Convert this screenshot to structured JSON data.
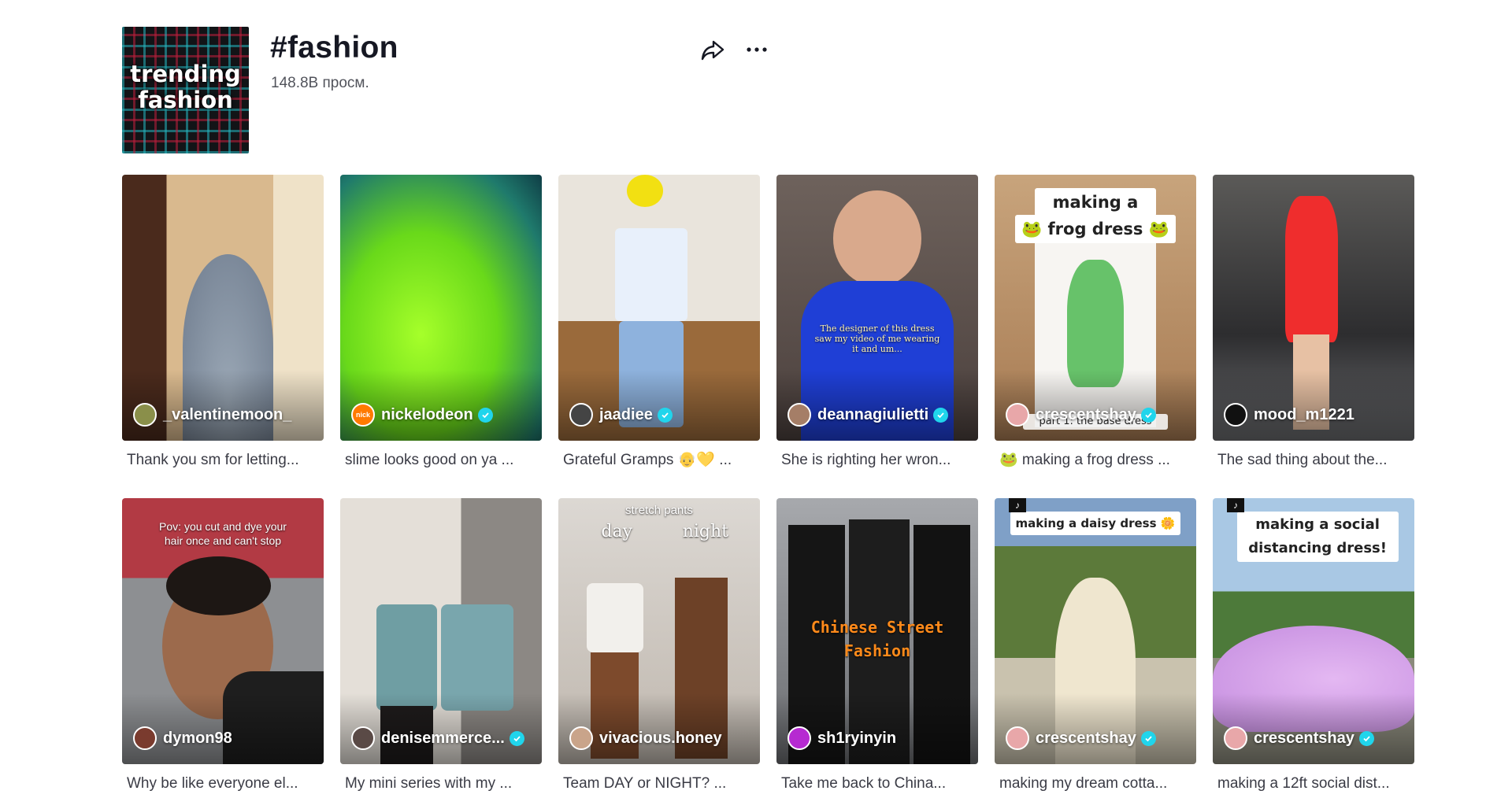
{
  "header": {
    "cover_text_line1": "trending",
    "cover_text_line2": "fashion",
    "title": "#fashion",
    "views": "148.8B просм."
  },
  "icons": {
    "share": "share-arrow-icon",
    "more": "more-dots-icon",
    "verified": "verified-check-icon"
  },
  "colors": {
    "verified": "#20d5ec",
    "text": "#161823"
  },
  "videos": [
    {
      "author": "_valentinemoon_",
      "verified": false,
      "caption": "Thank you sm for letting..."
    },
    {
      "author": "nickelodeon",
      "verified": true,
      "caption": "slime looks good on ya ...",
      "avatar_text": "nick"
    },
    {
      "author": "jaadiee",
      "verified": true,
      "caption": "Grateful Gramps 👴💛 ..."
    },
    {
      "author": "deannagiulietti",
      "verified": true,
      "caption": "She is righting her wron...",
      "overlay": "The designer of this dress saw my video of me wearing it and um..."
    },
    {
      "author": "crescentshay",
      "verified": true,
      "caption": "🐸 making a frog dress ...",
      "overlay_line1": "making a",
      "overlay_line2": "🐸 frog dress 🐸",
      "overlay_bottom": "part 1: the base dress"
    },
    {
      "author": "mood_m1221",
      "verified": false,
      "caption": "The sad thing about the..."
    },
    {
      "author": "dymon98",
      "verified": false,
      "caption": "Why be like everyone el...",
      "overlay": "Pov: you cut and dye your hair once and can't stop"
    },
    {
      "author": "denisemmerce...",
      "verified": true,
      "caption": "My mini series with my ..."
    },
    {
      "author": "vivacious.honey",
      "verified": false,
      "caption": "Team DAY or NIGHT? ...",
      "overlay_top": "stretch pants",
      "overlay_left": "day",
      "overlay_right": "night"
    },
    {
      "author": "sh1ryinyin",
      "verified": false,
      "caption": "Take me back to China...",
      "overlay_line1": "Chinese Street",
      "overlay_line2": "Fashion"
    },
    {
      "author": "crescentshay",
      "verified": true,
      "caption": "making my dream cotta...",
      "overlay": "making a daisy dress 🌼"
    },
    {
      "author": "crescentshay",
      "verified": true,
      "caption": "making a 12ft social dist...",
      "overlay_line1": "making a social",
      "overlay_line2": "distancing dress!"
    }
  ]
}
